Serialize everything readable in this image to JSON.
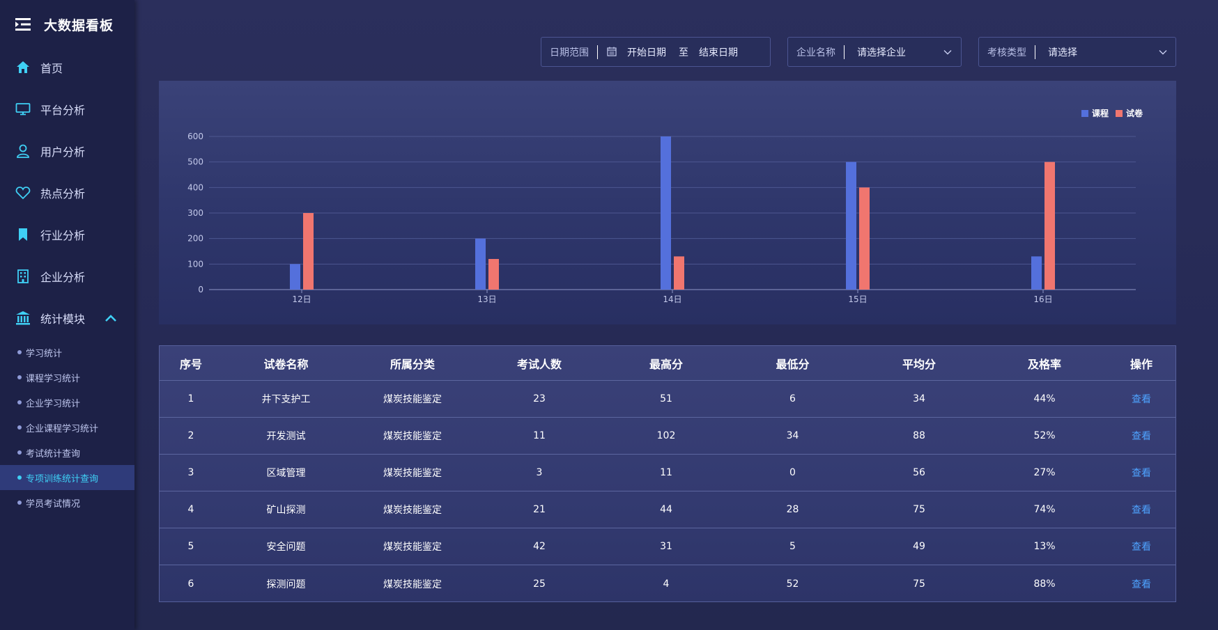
{
  "app": {
    "title": "大数据看板"
  },
  "sidebar": {
    "items": [
      {
        "label": "首页",
        "icon": "home-icon"
      },
      {
        "label": "平台分析",
        "icon": "monitor-icon"
      },
      {
        "label": "用户分析",
        "icon": "user-icon"
      },
      {
        "label": "热点分析",
        "icon": "heart-icon"
      },
      {
        "label": "行业分析",
        "icon": "bookmark-icon"
      },
      {
        "label": "企业分析",
        "icon": "building-icon"
      },
      {
        "label": "统计模块",
        "icon": "bank-icon",
        "expanded": true
      }
    ],
    "sub_items": [
      {
        "label": "学习统计"
      },
      {
        "label": "课程学习统计"
      },
      {
        "label": "企业学习统计"
      },
      {
        "label": "企业课程学习统计"
      },
      {
        "label": "考试统计查询"
      },
      {
        "label": "专项训练统计查询",
        "active": true
      },
      {
        "label": "学员考试情况"
      }
    ]
  },
  "filters": {
    "date": {
      "label": "日期范围",
      "start_placeholder": "开始日期",
      "to": "至",
      "end_placeholder": "结束日期"
    },
    "company": {
      "label": "企业名称",
      "placeholder": "请选择企业"
    },
    "exam_type": {
      "label": "考核类型",
      "placeholder": "请选择"
    }
  },
  "colors": {
    "accent": "#3fd0f5",
    "series_course": "#5470dc",
    "series_paper": "#f0766f",
    "link": "#4ea3ff"
  },
  "chart_data": {
    "type": "bar",
    "categories": [
      "12日",
      "13日",
      "14日",
      "15日",
      "16日"
    ],
    "series": [
      {
        "name": "课程",
        "values": [
          100,
          200,
          600,
          500,
          130
        ]
      },
      {
        "name": "试卷",
        "values": [
          300,
          120,
          130,
          400,
          500
        ]
      }
    ],
    "ylim": [
      0,
      600
    ],
    "yticks": [
      "0",
      "100",
      "200",
      "300",
      "400",
      "500",
      "600"
    ],
    "grid": true,
    "legend": "top-right"
  },
  "table": {
    "headers": [
      "序号",
      "试卷名称",
      "所属分类",
      "考试人数",
      "最高分",
      "最低分",
      "平均分",
      "及格率",
      "操作"
    ],
    "rows": [
      [
        "1",
        "井下支护工",
        "煤炭技能鉴定",
        "23",
        "51",
        "6",
        "34",
        "44%",
        "查看"
      ],
      [
        "2",
        "开发测试",
        "煤炭技能鉴定",
        "11",
        "102",
        "34",
        "88",
        "52%",
        "查看"
      ],
      [
        "3",
        "区域管理",
        "煤炭技能鉴定",
        "3",
        "11",
        "0",
        "56",
        "27%",
        "查看"
      ],
      [
        "4",
        "矿山探测",
        "煤炭技能鉴定",
        "21",
        "44",
        "28",
        "75",
        "74%",
        "查看"
      ],
      [
        "5",
        "安全问题",
        "煤炭技能鉴定",
        "42",
        "31",
        "5",
        "49",
        "13%",
        "查看"
      ],
      [
        "6",
        "探测问题",
        "煤炭技能鉴定",
        "25",
        "4",
        "52",
        "75",
        "88%",
        "查看"
      ]
    ]
  }
}
